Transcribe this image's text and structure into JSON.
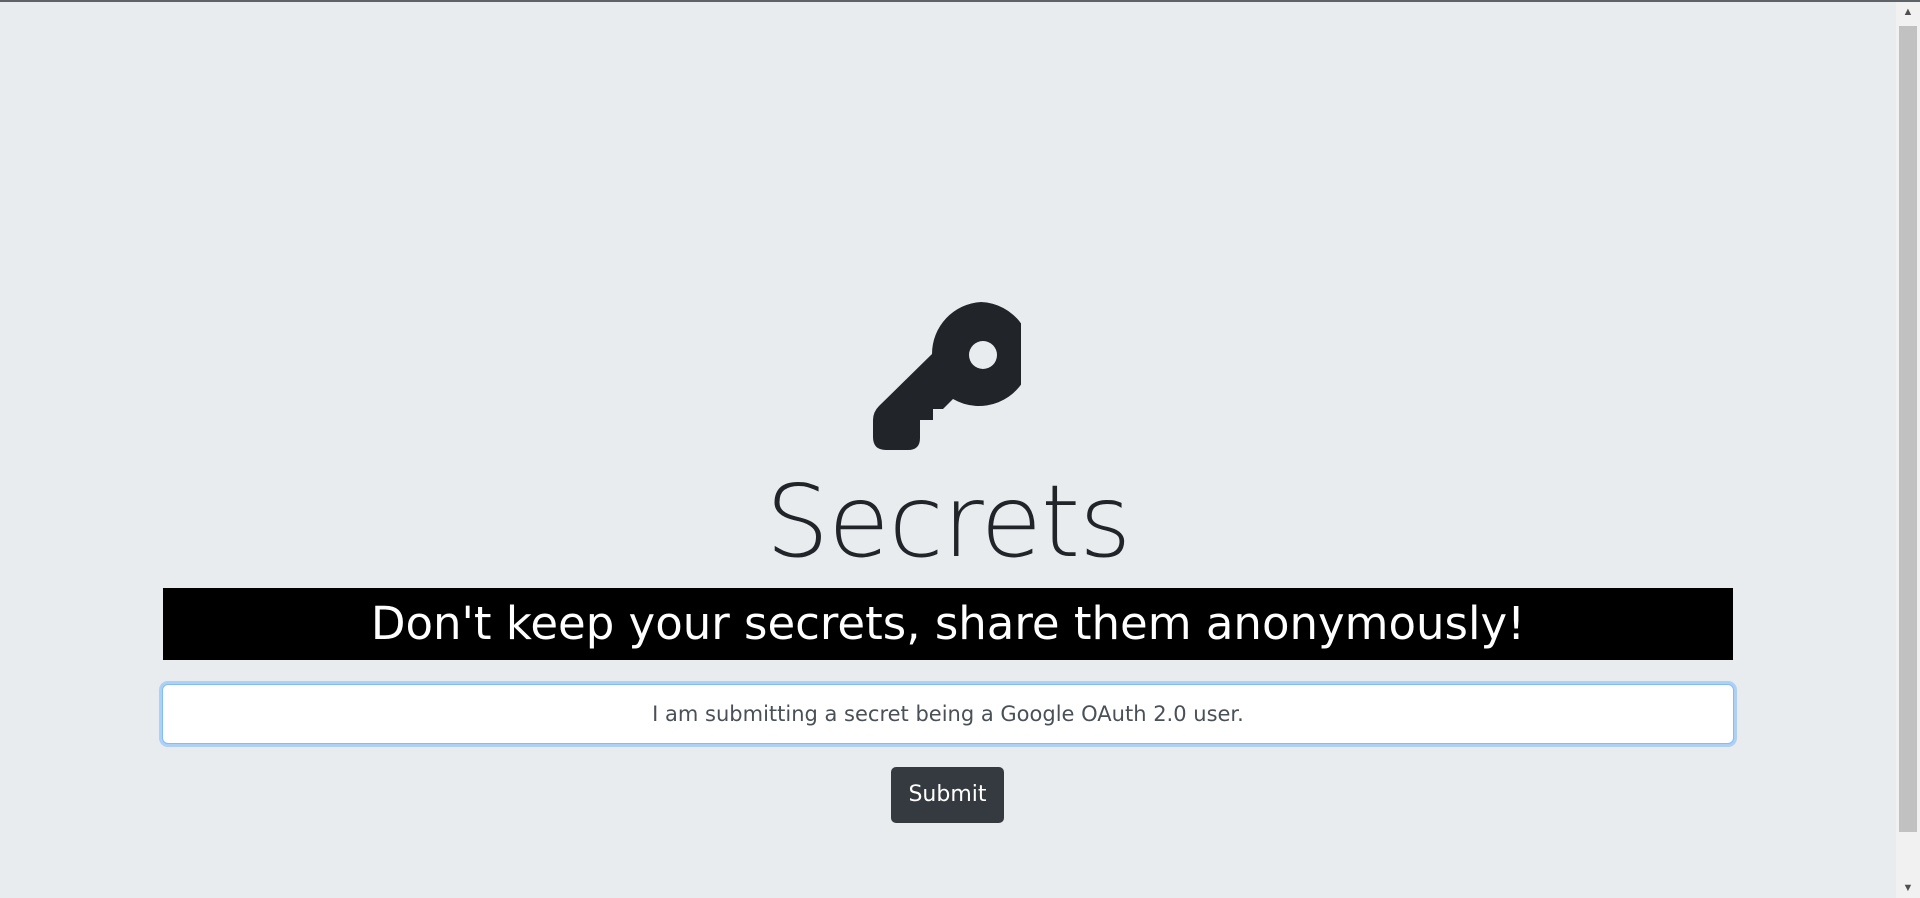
{
  "page": {
    "title": "Secrets",
    "tagline": "Don't keep your secrets, share them anonymously!",
    "icon": "key-icon"
  },
  "form": {
    "secret_value": "I am submitting a secret being a Google OAuth 2.0 user.",
    "submit_label": "Submit"
  },
  "colors": {
    "background": "#e9ecef",
    "banner": "#000000",
    "button": "#343a40",
    "input_focus": "#80bdff"
  },
  "scrollbar": {
    "up_arrow_icon": "triangle-up",
    "down_arrow_icon": "triangle-down"
  }
}
